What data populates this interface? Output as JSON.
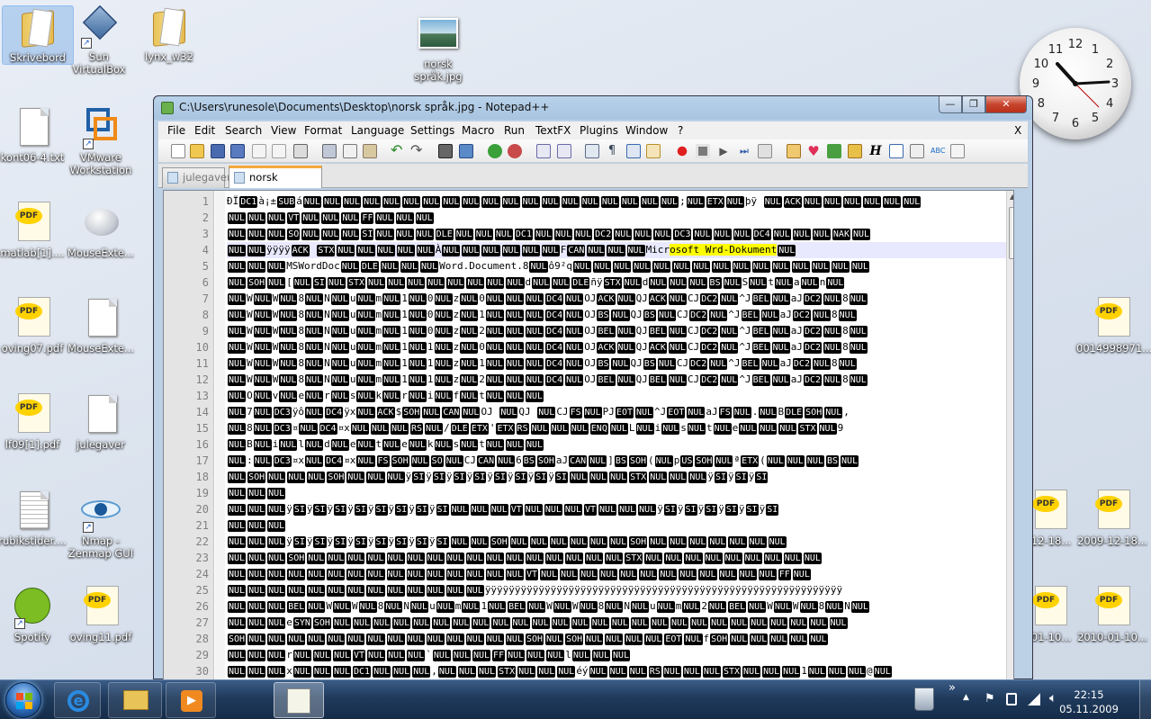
{
  "desktop_icons": [
    {
      "label": "Skrivebord"
    },
    {
      "label": "Sun\nVirtualBox"
    },
    {
      "label": "lynx_w32"
    },
    {
      "label": "norsk\nspråk.jpg"
    },
    {
      "label": "kont06-4.txt"
    },
    {
      "label": "VMware\nWorkstation"
    },
    {
      "label": "matlab[1]...."
    },
    {
      "label": "MouseExte..."
    },
    {
      "label": "oving07.pdf"
    },
    {
      "label": "MouseExte..."
    },
    {
      "label": "lf09[1].pdf"
    },
    {
      "label": "julegaver"
    },
    {
      "label": "rubikstider...."
    },
    {
      "label": "Nmap -\nZenmap GUI"
    },
    {
      "label": "Spotify"
    },
    {
      "label": "oving11.pdf"
    },
    {
      "label": "0014998971...."
    },
    {
      "label": "2009-12-18..."
    },
    {
      "label": "2010-01-10..."
    }
  ],
  "window": {
    "title": "C:\\Users\\runesole\\Documents\\Desktop\\norsk språk.jpg - Notepad++",
    "minimize": "—",
    "maximize": "❐",
    "close": "✕",
    "menu": [
      "File",
      "Edit",
      "Search",
      "View",
      "Format",
      "Language",
      "Settings",
      "Macro",
      "Run",
      "TextFX",
      "Plugins",
      "Window",
      "?"
    ],
    "menu_close": "X",
    "tabs": [
      {
        "label": "julegaver",
        "active": false
      },
      {
        "label": "norsk språk.jpg",
        "active": true
      }
    ]
  },
  "editor": {
    "lines": [
      "ÐÏ[DC1]à¡±[SUB]á[NUL][NUL][NUL][NUL][NUL][NUL][NUL][NUL][NUL][NUL][NUL][NUL][NUL][NUL][NUL][NUL][NUL][NUL][NUL];[NUL][ETX][NUL]þÿ  [NUL][ACK][NUL][NUL][NUL][NUL][NUL][NUL]",
      "[NUL][NUL][NUL][VT][NUL][NUL][NUL][FF][NUL][NUL][NUL]",
      "[NUL][NUL][NUL][SO][NUL][NUL][NUL][SI][NUL][NUL][NUL][DLE][NUL][NUL][NUL][DC1][NUL][NUL][NUL][DC2][NUL][NUL][NUL][DC3][NUL][NUL][NUL][DC4][NUL][NUL][NUL][NAK][NUL]",
      "[NUL][NUL]ÿÿÿÿ[ACK]  [STX][NUL][NUL][NUL][NUL][NUL]À[NUL][NUL][NUL][NUL][NUL][NUL]F[CAN][NUL][NUL][NUL]Microsoft Wrd-Dokument[NUL]",
      "[NUL][NUL][NUL]MSWordDoc[NUL][DLE][NUL][NUL][NUL]Word.Document.8[NUL]ô9²q[NUL][NUL][NUL][NUL][NUL][NUL][NUL][NUL][NUL][NUL][NUL][NUL][NUL][NUL][NUL]",
      "[NUL][SOH][NUL][[NUL][SI][NUL][STX][NUL][NUL][NUL][NUL][NUL][NUL][NUL][NUL]d[NUL][NUL][DLE]ñÿ[STX][NUL]d[NUL][NUL][NUL][BS][NUL]S[NUL]t[NUL]a[NUL]n[NUL]",
      "[NUL]W[NUL]W[NUL]8[NUL]N[NUL]u[NUL]m[NUL]1[NUL]0[NUL]z[NUL]0[NUL][NUL][NUL][DC4][NUL]OJ[ACK][NUL]QJ[ACK][NUL]CJ[DC2][NUL]^J[BEL][NUL]aJ[DC2][NUL]8[NUL]",
      "[NUL]W[NUL]W[NUL]8[NUL]N[NUL]u[NUL]m[NUL]1[NUL]0[NUL]z[NUL]1[NUL][NUL][NUL][DC4][NUL]OJ[BS][NUL]QJ[BS][NUL]CJ[DC2][NUL]^J[BEL][NUL]aJ[DC2][NUL]8[NUL]",
      "[NUL]W[NUL]W[NUL]8[NUL]N[NUL]u[NUL]m[NUL]1[NUL]0[NUL]z[NUL]2[NUL][NUL][NUL][DC4][NUL]OJ[BEL][NUL]QJ[BEL][NUL]CJ[DC2][NUL]^J[BEL][NUL]aJ[DC2][NUL]8[NUL]",
      "[NUL]W[NUL]W[NUL]8[NUL]N[NUL]u[NUL]m[NUL]1[NUL]1[NUL]z[NUL]0[NUL][NUL][NUL][DC4][NUL]OJ[ACK][NUL]QJ[ACK][NUL]CJ[DC2][NUL]^J[BEL][NUL]aJ[DC2][NUL]8[NUL]",
      "[NUL]W[NUL]W[NUL]8[NUL]N[NUL]u[NUL]m[NUL]1[NUL]1[NUL]z[NUL]1[NUL][NUL][NUL][DC4][NUL]OJ[BS][NUL]QJ[BS][NUL]CJ[DC2][NUL]^J[BEL][NUL]aJ[DC2][NUL]8[NUL]",
      "[NUL]W[NUL]W[NUL]8[NUL]N[NUL]u[NUL]m[NUL]1[NUL]1[NUL]z[NUL]2[NUL][NUL][NUL][DC4][NUL]OJ[BEL][NUL]QJ[BEL][NUL]CJ[DC2][NUL]^J[BEL][NUL]aJ[DC2][NUL]8[NUL]",
      "[NUL]O[NUL]v[NUL]e[NUL]r[NUL]s[NUL]k[NUL]r[NUL]i[NUL]f[NUL]t[NUL][NUL][NUL]",
      "[NUL]7[NUL][DC3]ÿô[NUL][DC4]ÿx[NUL][ACK]$[SOH][NUL][CAN][NUL]OJ  [NUL]QJ  [NUL]CJ[FS][NUL]PJ[EOT][NUL]^J[EOT][NUL]aJ[FS][NUL].[NUL]B[DLE][SOH][NUL],",
      "[NUL]8[NUL][DC3]¤[NUL][DC4]¤x[NUL][NUL][NUL][RS][NUL]/[DLE][ETX]'[ETX][RS][NUL][NUL][NUL][ENQ][NUL]L[NUL]i[NUL]s[NUL]t[NUL]e[NUL][NUL][NUL][STX][NUL]9",
      "[NUL]B[NUL]i[NUL]l[NUL]d[NUL]e[NUL]t[NUL]e[NUL]k[NUL]s[NUL]t[NUL][NUL][NUL]",
      "[NUL]:[NUL][DC3]¤x[NUL][DC4]¤x[NUL][FS][SOH][NUL][SO][NUL]CJ[CAN][NUL]6[BS][SOH]aJ[CAN][NUL]][BS][SOH]([NUL]p[US][SOH][NUL]ª[ETX]([NUL][NUL][NUL][BS][NUL]",
      "[NUL][SOH][NUL][NUL][NUL][SOH][NUL][NUL][NUL]ÿ[SI]ÿ[SI]ÿ[SI]ÿ[SI]ÿ[SI]ÿ[SI]ÿ[SI]ÿ[SI][NUL][NUL][NUL][STX][NUL][NUL][NUL]ÿ[SI]ÿ[SI]ÿ[SI]",
      "[NUL][NUL][NUL]",
      "[NUL][NUL][NUL]ÿ[SI]ÿ[SI]ÿ[SI]ÿ[SI]ÿ[SI]ÿ[SI]ÿ[SI]ÿ[SI][NUL][NUL][NUL][VT][NUL][NUL][NUL][VT][NUL][NUL][NUL]ÿ[SI]ÿ[SI]ÿ[SI]ÿ[SI]ÿ[SI]ÿ[SI]",
      "[NUL][NUL][NUL]",
      "[NUL][NUL][NUL]ÿ[SI]ÿ[SI]ÿ[SI]ÿ[SI]ÿ[SI]ÿ[SI]ÿ[SI]ÿ[SI][NUL][NUL][SOH][NUL][NUL][NUL][NUL][NUL][NUL][SOH][NUL][NUL][NUL][NUL][NUL][NUL][NUL]",
      "[NUL][NUL][NUL][SOH][NUL][NUL][NUL][NUL][NUL][NUL][NUL][NUL][NUL][NUL][NUL][NUL][NUL][NUL][NUL][NUL][STX][NUL][NUL][NUL][NUL][NUL][NUL][NUL][NUL][NUL]",
      "[NUL][NUL][NUL][NUL][NUL][NUL][NUL][NUL][NUL][NUL][NUL][NUL][NUL][NUL][NUL][VT][NUL][NUL][NUL][NUL][NUL][NUL][NUL][NUL][NUL][NUL][NUL][NUL][FF][NUL]",
      "[NUL][NUL][NUL][NUL][NUL][NUL][NUL][NUL][NUL][NUL][NUL][NUL][NUL]ÿÿÿÿÿÿÿÿÿÿÿÿÿÿÿÿÿÿÿÿÿÿÿÿÿÿÿÿÿÿÿÿÿÿÿÿÿÿÿÿÿÿÿÿÿÿÿÿÿÿÿÿÿÿÿÿÿÿÿÿ",
      "[NUL][NUL][NUL][BEL][NUL]W[NUL]W[NUL]8[NUL]N[NUL]u[NUL]m[NUL]1[NUL][BEL][NUL]W[NUL]W[NUL]8[NUL]N[NUL]u[NUL]m[NUL]2[NUL][BEL][NUL]W[NUL]W[NUL]8[NUL]N[NUL]",
      "[NUL][NUL][NUL]e[SYN][SOH][NUL][NUL][NUL][NUL][NUL][NUL][NUL][NUL][NUL][NUL][NUL][NUL][NUL][NUL][NUL][NUL][NUL][NUL][NUL][NUL][NUL][NUL][NUL][NUL][NUL][NUL]",
      "[SOH][NUL][NUL][NUL][NUL][NUL][NUL][NUL][NUL][NUL][NUL][NUL][NUL][NUL][NUL][SOH][NUL][SOH][NUL][NUL][NUL][NUL][EOT][NUL]f[SOH][NUL][NUL][NUL][NUL][NUL]",
      "[NUL][NUL][NUL]r[NUL][NUL][NUL][VT][NUL][NUL][NUL]`[NUL][NUL][NUL][FF][NUL][NUL][NUL]l[NUL][NUL][NUL]",
      "[NUL][NUL][NUL]x[NUL][NUL][NUL][DC1][NUL][NUL][NUL],[NUL][NUL][NUL][STX][NUL][NUL][NUL]éý[NUL][NUL][NUL][RS][NUL][NUL][NUL][STX][NUL][NUL][NUL]1[NUL][NUL][NUL]@[NUL]"
    ],
    "current_line": 4,
    "highlight_text": "osoft Wrd-Dokument"
  },
  "clock_widget": {
    "numbers": [
      "12",
      "1",
      "2",
      "3",
      "4",
      "5",
      "6",
      "7",
      "8",
      "9",
      "10",
      "11"
    ]
  },
  "taskbar": {
    "time": "22:15",
    "date": "05.11.2009",
    "overflow": "»"
  }
}
